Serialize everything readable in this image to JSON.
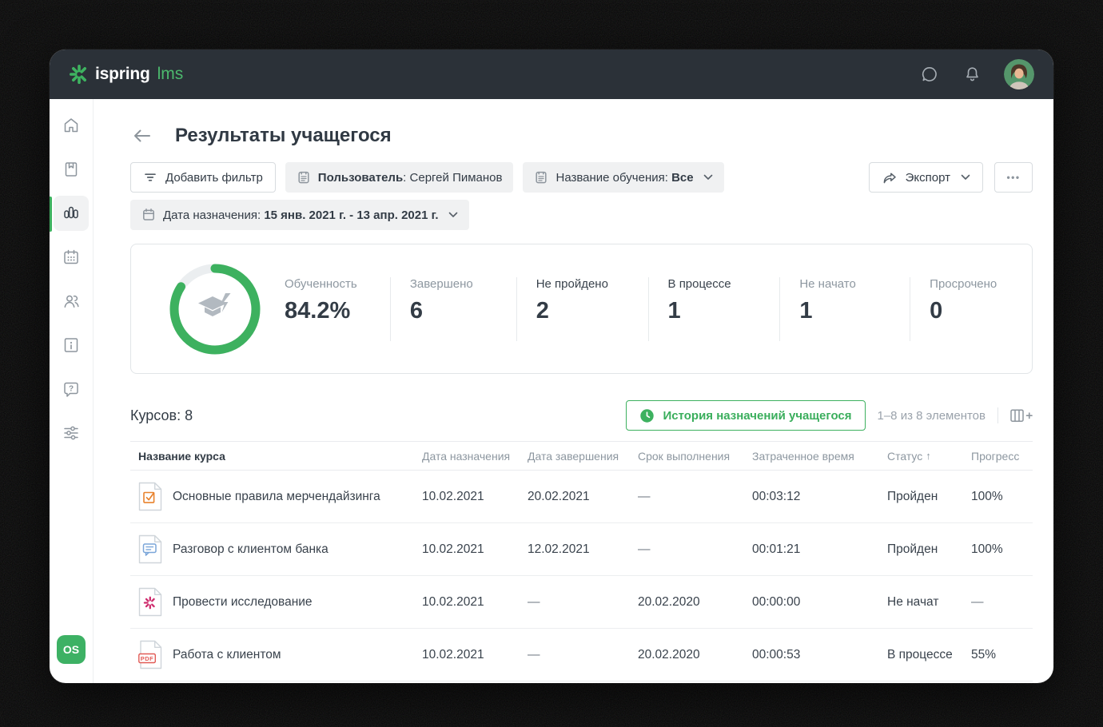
{
  "header": {
    "brand": "ispring",
    "product": "lms"
  },
  "page": {
    "title": "Результаты учащегося"
  },
  "filters": {
    "add_filter_label": "Добавить фильтр",
    "user_chip": {
      "label": "Пользователь",
      "separator": ": ",
      "value": "Сергей Пиманов"
    },
    "training_chip": {
      "label": "Название обучения",
      "separator": ": ",
      "value": "Все"
    },
    "date_chip": {
      "label": "Дата назначения",
      "separator": ": ",
      "value": "15 янв. 2021 г. - 13 апр. 2021 г."
    },
    "export_label": "Экспорт",
    "more_label": "•••"
  },
  "stats": {
    "ring_percent": 84.2,
    "colors": {
      "ring": "#3db15f",
      "track": "#ebeef0"
    },
    "items": [
      {
        "label": "Обученность",
        "value": "84.2%"
      },
      {
        "label": "Завершено",
        "value": "6"
      },
      {
        "label": "Не пройдено",
        "value": "2"
      },
      {
        "label": "В процессе",
        "value": "1"
      },
      {
        "label": "Не начато",
        "value": "1"
      },
      {
        "label": "Просрочено",
        "value": "0"
      }
    ]
  },
  "courses": {
    "count_label": "Курсов: 8",
    "history_label": "История назначений учащегося",
    "pagination": "1–8 из 8 элементов",
    "sort_arrow": "↑",
    "columns": [
      "Название курса",
      "Дата назначения",
      "Дата завершения",
      "Срок выполнения",
      "Затраченное время",
      "Статус",
      "Прогресс"
    ],
    "rows": [
      {
        "icon": "quiz-doc-icon",
        "name": "Основные правила мерчендайзинга",
        "assigned": "10.02.2021",
        "completed": "20.02.2021",
        "due": "—",
        "time": "00:03:12",
        "status": "Пройден",
        "progress": "100%"
      },
      {
        "icon": "dialog-doc-icon",
        "name": "Разговор с клиентом банка",
        "assigned": "10.02.2021",
        "completed": "12.02.2021",
        "due": "—",
        "time": "00:01:21",
        "status": "Пройден",
        "progress": "100%"
      },
      {
        "icon": "ispring-doc-icon",
        "name": "Провести  исследование",
        "assigned": "10.02.2021",
        "completed": "—",
        "due": "20.02.2020",
        "time": "00:00:00",
        "status": "Не начат",
        "progress": "—"
      },
      {
        "icon": "pdf-doc-icon",
        "name": "Работа с клиентом",
        "assigned": "10.02.2021",
        "completed": "—",
        "due": "20.02.2020",
        "time": "00:00:53",
        "status": "В процессе",
        "progress": "55%"
      }
    ]
  },
  "sidebar": {
    "icons": [
      "home-icon",
      "book-icon",
      "reports-icon",
      "calendar-icon",
      "users-icon",
      "info-doc-icon",
      "help-bubble-icon",
      "sliders-icon"
    ],
    "active_item": "reports",
    "badge": "OS"
  }
}
